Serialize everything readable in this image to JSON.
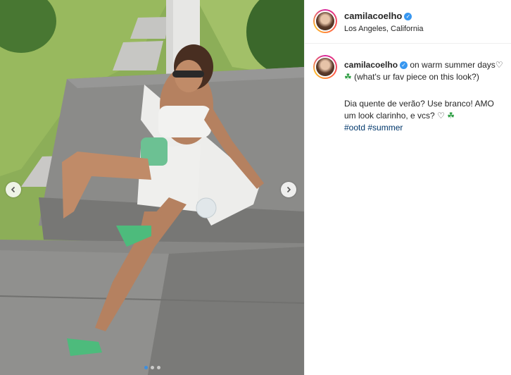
{
  "post": {
    "username": "camilacoelho",
    "location": "Los Angeles, California",
    "caption": {
      "line1_before_icons": "on warm summer days",
      "line1_after_icons": "(what's ur fav piece on this look?)",
      "line2": "Dia quente de verão? Use branco! AMO um look clarinho, e vcs?",
      "hashtags": [
        "#ootd",
        "#summer"
      ]
    }
  },
  "carousel": {
    "slides": 3,
    "active_index": 0
  },
  "icons": {
    "verified": "verified-badge-icon",
    "heart": "white-heart-emoji-icon",
    "shamrock": "shamrock-emoji-icon",
    "prev": "chevron-left-icon",
    "next": "chevron-right-icon"
  },
  "colors": {
    "verified": "#3897f0",
    "hashtag": "#00376b",
    "active_dot": "#3d8fe0"
  }
}
